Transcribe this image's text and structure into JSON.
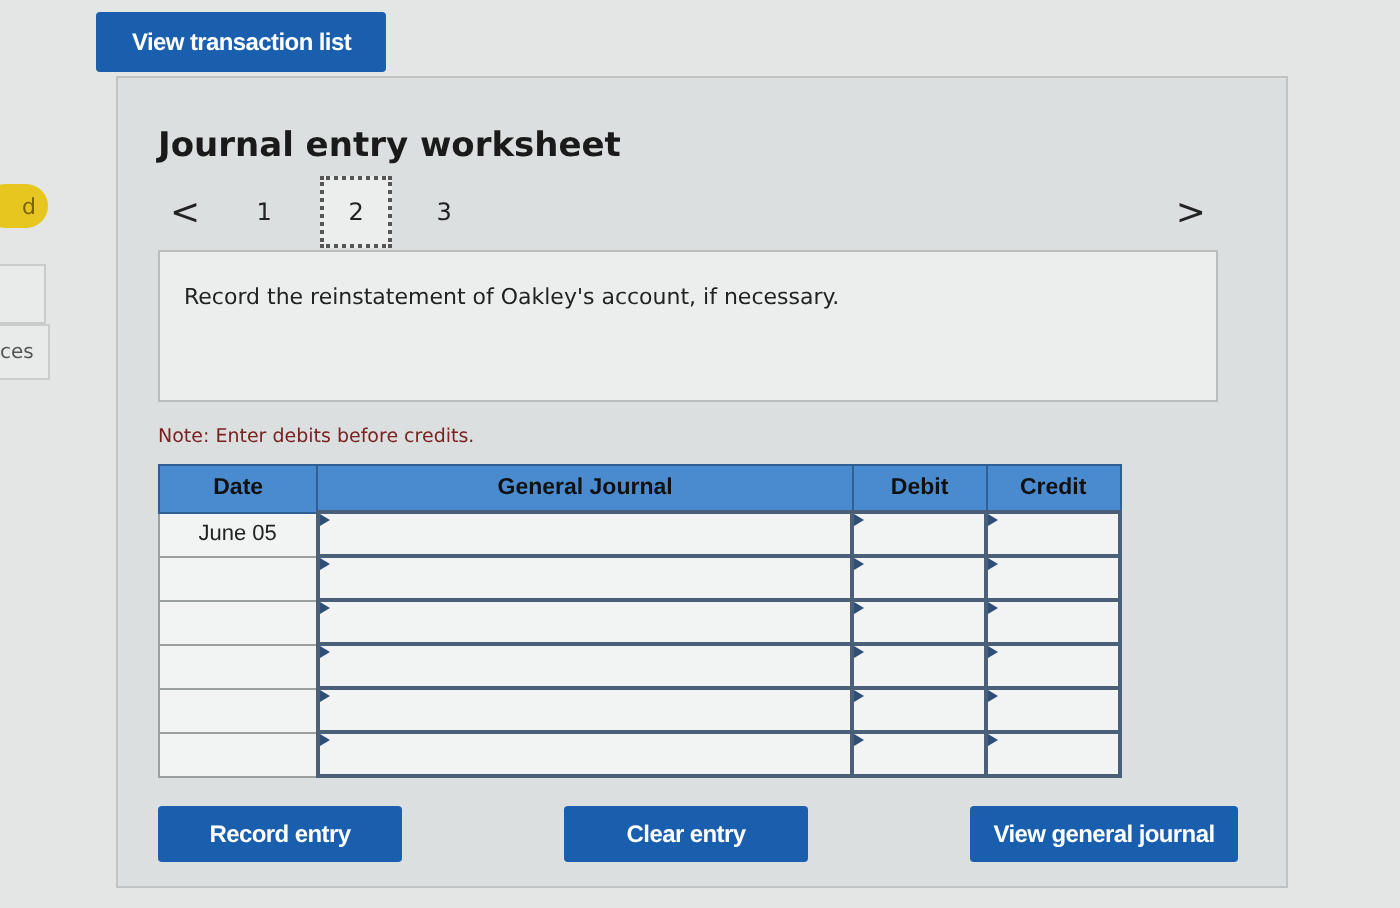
{
  "sidebar": {
    "badge": "d",
    "label": "ces"
  },
  "top_button": "View transaction list",
  "worksheet": {
    "title": "Journal entry worksheet",
    "previous": "<",
    "next": ">",
    "pages": [
      {
        "label": "1",
        "selected": false
      },
      {
        "label": "2",
        "selected": true
      },
      {
        "label": "3",
        "selected": false
      }
    ],
    "instruction": "Record the reinstatement of Oakley's account, if necessary.",
    "note": "Note: Enter debits before credits.",
    "table": {
      "columns": [
        "Date",
        "General Journal",
        "Debit",
        "Credit"
      ],
      "rows": [
        {
          "date": "June 05"
        },
        {},
        {},
        {},
        {},
        {}
      ]
    },
    "buttons": [
      "Record entry",
      "Clear entry",
      "View general journal"
    ]
  }
}
